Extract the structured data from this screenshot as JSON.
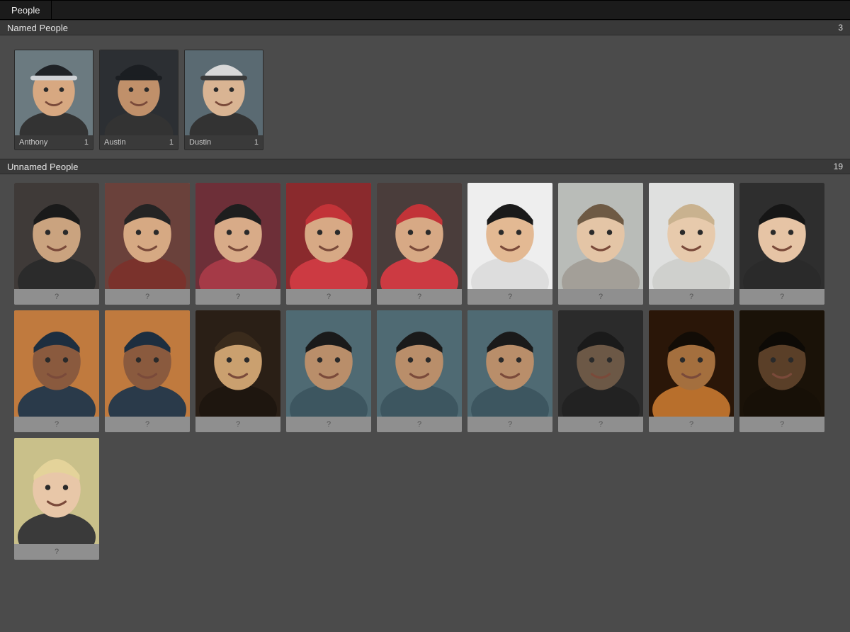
{
  "tab": {
    "label": "People"
  },
  "sections": {
    "named": {
      "title": "Named People",
      "count": "3",
      "items": [
        {
          "name": "Anthony",
          "count": "1",
          "bg": "#6b7a80",
          "skin": "#d7a881",
          "hat": "#1f2226",
          "brim": "#cfd2d6"
        },
        {
          "name": "Austin",
          "count": "1",
          "bg": "#2c2f33",
          "skin": "#c0906a",
          "hat": "#1b1e22",
          "brim": "#1b1e22"
        },
        {
          "name": "Dustin",
          "count": "1",
          "bg": "#5a6a72",
          "skin": "#d9b493",
          "hat": "#d8d8d8",
          "brim": "#3a3a3a"
        }
      ]
    },
    "unnamed": {
      "title": "Unnamed People",
      "count": "19",
      "placeholder": "?",
      "items": [
        {
          "bg": "#3f3a38",
          "skin": "#caa37f",
          "hair": "#1a1a1a",
          "accent": "#2b2b2b"
        },
        {
          "bg": "#6a413b",
          "skin": "#d6a983",
          "hair": "#242424",
          "accent": "#7a322c"
        },
        {
          "bg": "#6d2f38",
          "skin": "#d8ab88",
          "hair": "#1e1e1e",
          "accent": "#a53a47"
        },
        {
          "bg": "#8a2a2d",
          "skin": "#d7a985",
          "hair": "#c23338",
          "accent": "#cc3a42"
        },
        {
          "bg": "#4a3d3b",
          "skin": "#d7a985",
          "hair": "#c23338",
          "accent": "#cc3a42"
        },
        {
          "bg": "#eeeeee",
          "skin": "#e3b993",
          "hair": "#1a1a1a",
          "accent": "#dddddd"
        },
        {
          "bg": "#b9bcb8",
          "skin": "#e4c5a6",
          "hair": "#6e5a44",
          "accent": "#a39f98"
        },
        {
          "bg": "#dfe0df",
          "skin": "#e7caac",
          "hair": "#c9b28f",
          "accent": "#cfd0cd"
        },
        {
          "bg": "#2e2e2e",
          "skin": "#e6c4a5",
          "hair": "#161616",
          "accent": "#2a2a2a"
        },
        {
          "bg": "#c07a3e",
          "skin": "#8a5a3e",
          "hair": "#1d2e3f",
          "accent": "#2a3a4a"
        },
        {
          "bg": "#c07a3e",
          "skin": "#8a5a3e",
          "hair": "#1d2e3f",
          "accent": "#2a3a4a"
        },
        {
          "bg": "#2a1f16",
          "skin": "#caa06f",
          "hair": "#3a2b1c",
          "accent": "#1e160f"
        },
        {
          "bg": "#4f6a73",
          "skin": "#b98e6a",
          "hair": "#1a1a1a",
          "accent": "#3d5660"
        },
        {
          "bg": "#4f6a73",
          "skin": "#b98e6a",
          "hair": "#1a1a1a",
          "accent": "#3d5660"
        },
        {
          "bg": "#4f6a73",
          "skin": "#b98e6a",
          "hair": "#1a1a1a",
          "accent": "#3d5660"
        },
        {
          "bg": "#2b2b2b",
          "skin": "#6c5846",
          "hair": "#1a1a1a",
          "accent": "#222"
        },
        {
          "bg": "#2a1608",
          "skin": "#a46f3e",
          "hair": "#120c06",
          "accent": "#b86f2c"
        },
        {
          "bg": "#1a1208",
          "skin": "#5a3f28",
          "hair": "#0d0a06",
          "accent": "#171007"
        },
        {
          "bg": "#c9c08a",
          "skin": "#e8c7a8",
          "hair": "#e4d39a",
          "accent": "#3a3a3a"
        }
      ]
    }
  }
}
